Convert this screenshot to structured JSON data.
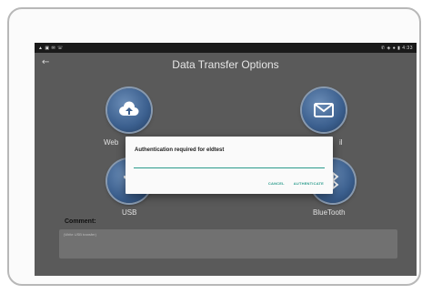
{
  "status_bar": {
    "left_icons": "▲ ▣ ✉ ☏",
    "right_info": "✆ ◈ ● ▮ 4:33"
  },
  "header": {
    "back_glyph": "←",
    "title": "Data Transfer Options"
  },
  "options": [
    {
      "label": "Web",
      "icon": "cloud-upload-icon"
    },
    {
      "label": "il",
      "icon": "envelope-icon"
    },
    {
      "label": "USB",
      "icon": "usb-icon"
    },
    {
      "label": "BlueTooth",
      "icon": "bluetooth-icon"
    }
  ],
  "comment": {
    "label": "Comment:",
    "placeholder": "(Write USB transfer)"
  },
  "dialog": {
    "title": "Authentication required for eldtest",
    "cancel_label": "CANCEL",
    "authenticate_label": "AUTHENTICATE"
  },
  "colors": {
    "screen_dim": "#5a5a5a",
    "accent": "#2b9b8c",
    "icon_blue": "#3b5f8e"
  }
}
